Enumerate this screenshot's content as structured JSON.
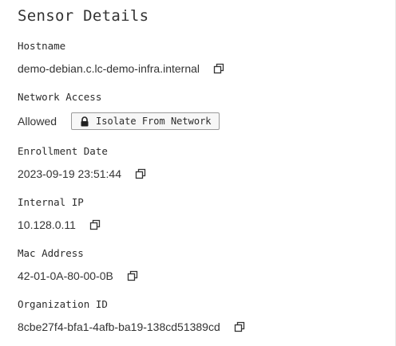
{
  "panel": {
    "title": "Sensor Details"
  },
  "fields": {
    "hostname": {
      "label": "Hostname",
      "value": "demo-debian.c.lc-demo-infra.internal"
    },
    "network_access": {
      "label": "Network Access",
      "value": "Allowed",
      "button_label": "Isolate From Network"
    },
    "enrollment_date": {
      "label": "Enrollment Date",
      "value": "2023-09-19 23:51:44"
    },
    "internal_ip": {
      "label": "Internal IP",
      "value": "10.128.0.11"
    },
    "mac_address": {
      "label": "Mac Address",
      "value": "42-01-0A-80-00-0B"
    },
    "organization_id": {
      "label": "Organization ID",
      "value": "8cbe27f4-bfa1-4afb-ba19-138cd51389cd"
    }
  },
  "icons": {
    "copy": "copy-icon",
    "lock": "lock-icon"
  },
  "colors": {
    "text": "#333333",
    "label": "#2b2b2b",
    "button_border": "#9a9a9a"
  }
}
